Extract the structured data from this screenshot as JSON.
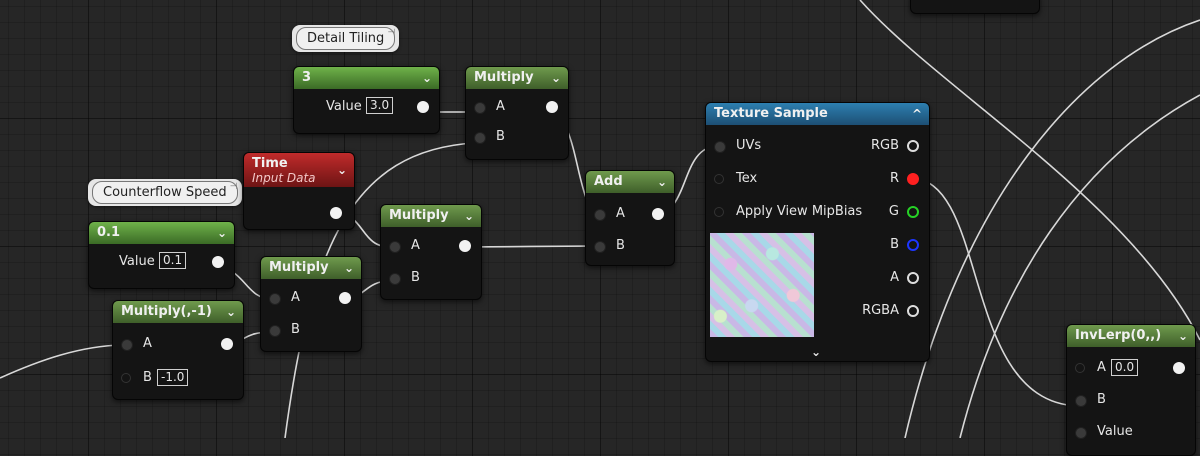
{
  "comments": {
    "detail_tiling": "Detail Tiling",
    "counterflow_speed": "Counterflow Speed"
  },
  "nodes": {
    "detail_tiling": {
      "title": "3",
      "value_label": "Value",
      "value": "3.0"
    },
    "counterflow_speed": {
      "title": "0.1",
      "value_label": "Value",
      "value": "0.1"
    },
    "time": {
      "title": "Time",
      "subtitle": "Input Data"
    },
    "multiply_top": {
      "title": "Multiply",
      "a": "A",
      "b": "B"
    },
    "multiply_mid": {
      "title": "Multiply",
      "a": "A",
      "b": "B"
    },
    "multiply_low": {
      "title": "Multiply",
      "a": "A",
      "b": "B"
    },
    "multiply_neg": {
      "title": "Multiply(,-1)",
      "a": "A",
      "b": "B",
      "b_value": "-1.0"
    },
    "add": {
      "title": "Add",
      "a": "A",
      "b": "B"
    },
    "texture_sample": {
      "title": "Texture Sample",
      "inputs": [
        "UVs",
        "Tex",
        "Apply View MipBias"
      ],
      "outputs": [
        "RGB",
        "R",
        "G",
        "B",
        "A",
        "RGBA"
      ]
    },
    "invlerp": {
      "title": "InvLerp(0,,)",
      "a": "A",
      "a_value": "0.0",
      "b": "B",
      "value": "Value"
    }
  },
  "icons": {
    "collapse": "chevron-down-icon",
    "expand": "chevron-up-icon",
    "pin": "pin-icon"
  },
  "colors": {
    "wire": "#d8d8d8",
    "r_pin": "#ff2020",
    "g_pin": "#26d226",
    "b_pin": "#1d36ff",
    "constant_header": "#5d8a3c",
    "time_header": "#b02424",
    "texture_header": "#2a6f9c"
  }
}
